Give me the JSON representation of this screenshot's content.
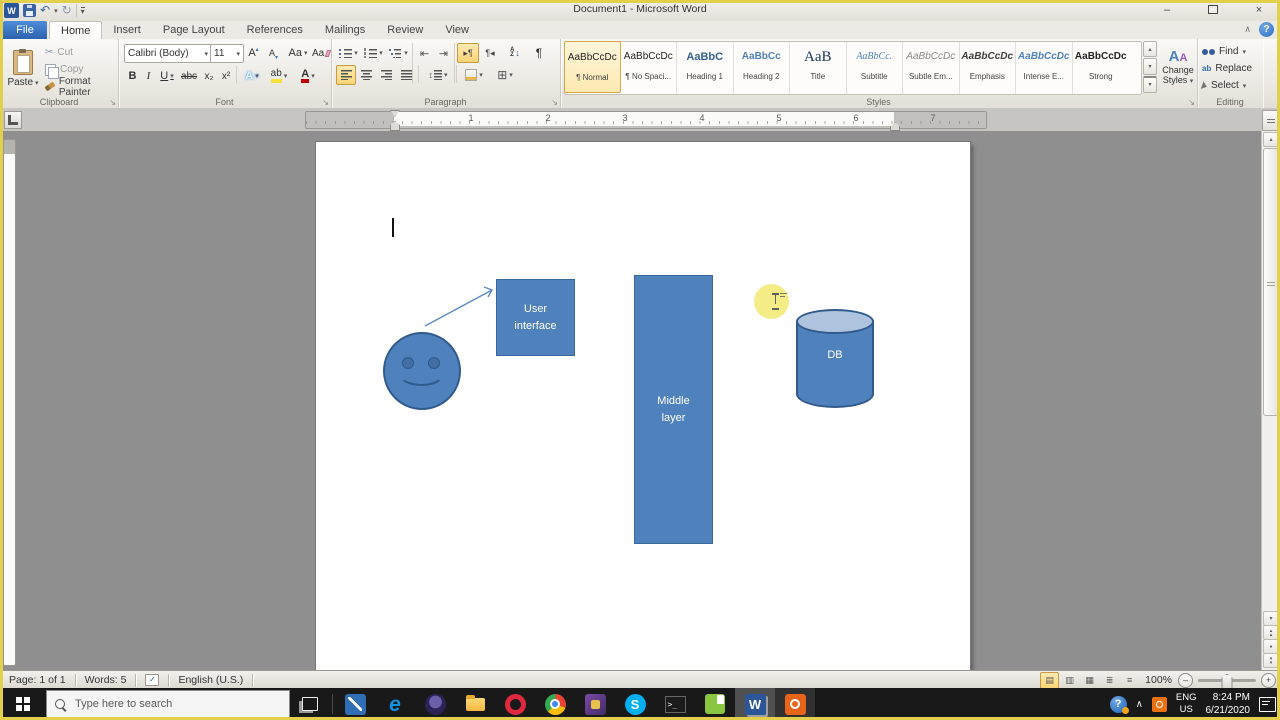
{
  "window": {
    "title": "Document1 - Microsoft Word"
  },
  "icons": {
    "word_letter": "W",
    "dropdown": "▾",
    "dropup": "▴",
    "undo": "↶",
    "redo": "↻",
    "minimize": "–",
    "close": "×",
    "collapse_ribbon": "∧",
    "help": "?",
    "launcher": "↘",
    "scissors": "✂",
    "pilcrow": "¶",
    "check": "✓",
    "borders_grid": "⊞",
    "line_spacing_arrows": "↕",
    "indent_decrease": "⇤",
    "indent_increase": "⇥",
    "ltr_mark": "▸¶",
    "rtl_mark": "¶◂",
    "sort_a": "A",
    "sort_z": "Z",
    "sort_arrow": "↓",
    "replace_ab": "ab",
    "terminal_prompt": ">_",
    "edge_letter": "e",
    "skype_letter": "S",
    "view_print_layout": "▤",
    "view_full_screen": "▥",
    "view_web_layout": "▦",
    "view_outline": "≣",
    "view_draft": "≡",
    "zoom_out": "–",
    "zoom_in": "+",
    "browse_circle": "●"
  },
  "ribbon": {
    "file_tab": "File",
    "tabs": [
      "Home",
      "Insert",
      "Page Layout",
      "References",
      "Mailings",
      "Review",
      "View"
    ],
    "clipboard": {
      "label": "Clipboard",
      "paste": "Paste",
      "cut": "Cut",
      "copy": "Copy",
      "format_painter": "Format Painter"
    },
    "font": {
      "label": "Font",
      "family": "Calibri (Body)",
      "size": "11",
      "bold": "B",
      "italic": "I",
      "underline": "U",
      "strike": "abc",
      "subscript": "x₂",
      "superscript": "x²",
      "grow": "A",
      "shrink": "A",
      "change_case": "Aa",
      "clear_format": "Aa",
      "glow": "A",
      "highlight": "ab",
      "font_color": "A"
    },
    "paragraph": {
      "label": "Paragraph"
    },
    "styles": {
      "label": "Styles",
      "change_styles_line1": "Change",
      "change_styles_line2": "Styles",
      "change_a1": "A",
      "change_a2": "A",
      "items": [
        {
          "preview": "AaBbCcDc",
          "name": "¶ Normal"
        },
        {
          "preview": "AaBbCcDc",
          "name": "¶ No Spaci..."
        },
        {
          "preview": "AaBbC",
          "name": "Heading 1"
        },
        {
          "preview": "AaBbCc",
          "name": "Heading 2"
        },
        {
          "preview": "AaB",
          "name": "Title"
        },
        {
          "preview": "AaBbCc.",
          "name": "Subtitle"
        },
        {
          "preview": "AaBbCcDc",
          "name": "Subtle Em..."
        },
        {
          "preview": "AaBbCcDc",
          "name": "Emphasis"
        },
        {
          "preview": "AaBbCcDc",
          "name": "Intense E..."
        },
        {
          "preview": "AaBbCcDc",
          "name": "Strong"
        }
      ]
    },
    "editing": {
      "label": "Editing",
      "find": "Find",
      "replace": "Replace",
      "select": "Select"
    }
  },
  "ruler": {
    "numbers": [
      "1",
      "2",
      "3",
      "4",
      "5",
      "6",
      "7"
    ]
  },
  "shapes": {
    "user_interface": "User interface",
    "middle_layer": "Middle layer",
    "db": "DB",
    "fill_color": "#4f81bd",
    "border_color": "#31598a",
    "highlight_color": "#f4ec86"
  },
  "status": {
    "page": "Page: 1 of 1",
    "words": "Words: 5",
    "language": "English (U.S.)",
    "zoom_level": "100%"
  },
  "taskbar": {
    "search_placeholder": "Type here to search",
    "tray": {
      "lang_line1": "ENG",
      "lang_line2": "US",
      "time": "8:24 PM",
      "date": "6/21/2020"
    }
  }
}
